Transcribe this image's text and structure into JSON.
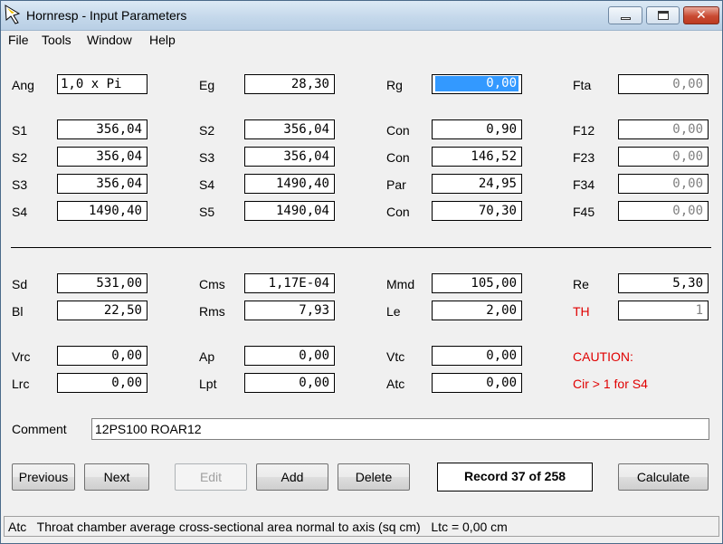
{
  "window": {
    "title": "Hornresp - Input Parameters",
    "app_icon": "hornresp-icon",
    "controls": {
      "minimize": "minimize-icon",
      "maximize": "maximize-icon",
      "close": "close-icon"
    }
  },
  "menu": [
    "File",
    "Tools",
    "Window",
    "Help"
  ],
  "rows": [
    [
      {
        "label": "Ang",
        "value": "1,0 x Pi"
      },
      {
        "label": "Eg",
        "value": "28,30"
      },
      {
        "label": "Rg",
        "value": "0,00"
      },
      {
        "label": "Fta",
        "value": "0,00"
      }
    ],
    [
      {
        "label": "S1",
        "value": "356,04"
      },
      {
        "label": "S2",
        "value": "356,04"
      },
      {
        "label": "Con",
        "value": "0,90"
      },
      {
        "label": "F12",
        "value": "0,00"
      }
    ],
    [
      {
        "label": "S2",
        "value": "356,04"
      },
      {
        "label": "S3",
        "value": "356,04"
      },
      {
        "label": "Con",
        "value": "146,52"
      },
      {
        "label": "F23",
        "value": "0,00"
      }
    ],
    [
      {
        "label": "S3",
        "value": "356,04"
      },
      {
        "label": "S4",
        "value": "1490,40"
      },
      {
        "label": "Par",
        "value": "24,95"
      },
      {
        "label": "F34",
        "value": "0,00"
      }
    ],
    [
      {
        "label": "S4",
        "value": "1490,40"
      },
      {
        "label": "S5",
        "value": "1490,04"
      },
      {
        "label": "Con",
        "value": "70,30"
      },
      {
        "label": "F45",
        "value": "0,00"
      }
    ],
    [
      {
        "label": "Sd",
        "value": "531,00"
      },
      {
        "label": "Cms",
        "value": "1,17E-04"
      },
      {
        "label": "Mmd",
        "value": "105,00"
      },
      {
        "label": "Re",
        "value": "5,30"
      }
    ],
    [
      {
        "label": "Bl",
        "value": "22,50"
      },
      {
        "label": "Rms",
        "value": "7,93"
      },
      {
        "label": "Le",
        "value": "2,00"
      },
      {
        "label": "TH",
        "value": "1"
      }
    ],
    [
      {
        "label": "Vrc",
        "value": "0,00"
      },
      {
        "label": "Ap",
        "value": "0,00"
      },
      {
        "label": "Vtc",
        "value": "0,00"
      },
      {
        "label": "CAUTION:"
      }
    ],
    [
      {
        "label": "Lrc",
        "value": "0,00"
      },
      {
        "label": "Lpt",
        "value": "0,00"
      },
      {
        "label": "Atc",
        "value": "0,00"
      },
      {
        "label": "Cir > 1 for S4"
      }
    ]
  ],
  "comment": {
    "label": "Comment",
    "value": "12PS100 ROAR12"
  },
  "buttons": {
    "previous": "Previous",
    "next": "Next",
    "edit": "Edit",
    "add": "Add",
    "delete": "Delete",
    "calculate": "Calculate"
  },
  "record": "Record 37 of 258",
  "status": {
    "field": "Atc",
    "description": "Throat chamber average cross-sectional area normal to axis  (sq cm)",
    "value": "Ltc = 0,00 cm"
  },
  "colors": {
    "warning": "#e00000",
    "selection": "#3399ff"
  }
}
